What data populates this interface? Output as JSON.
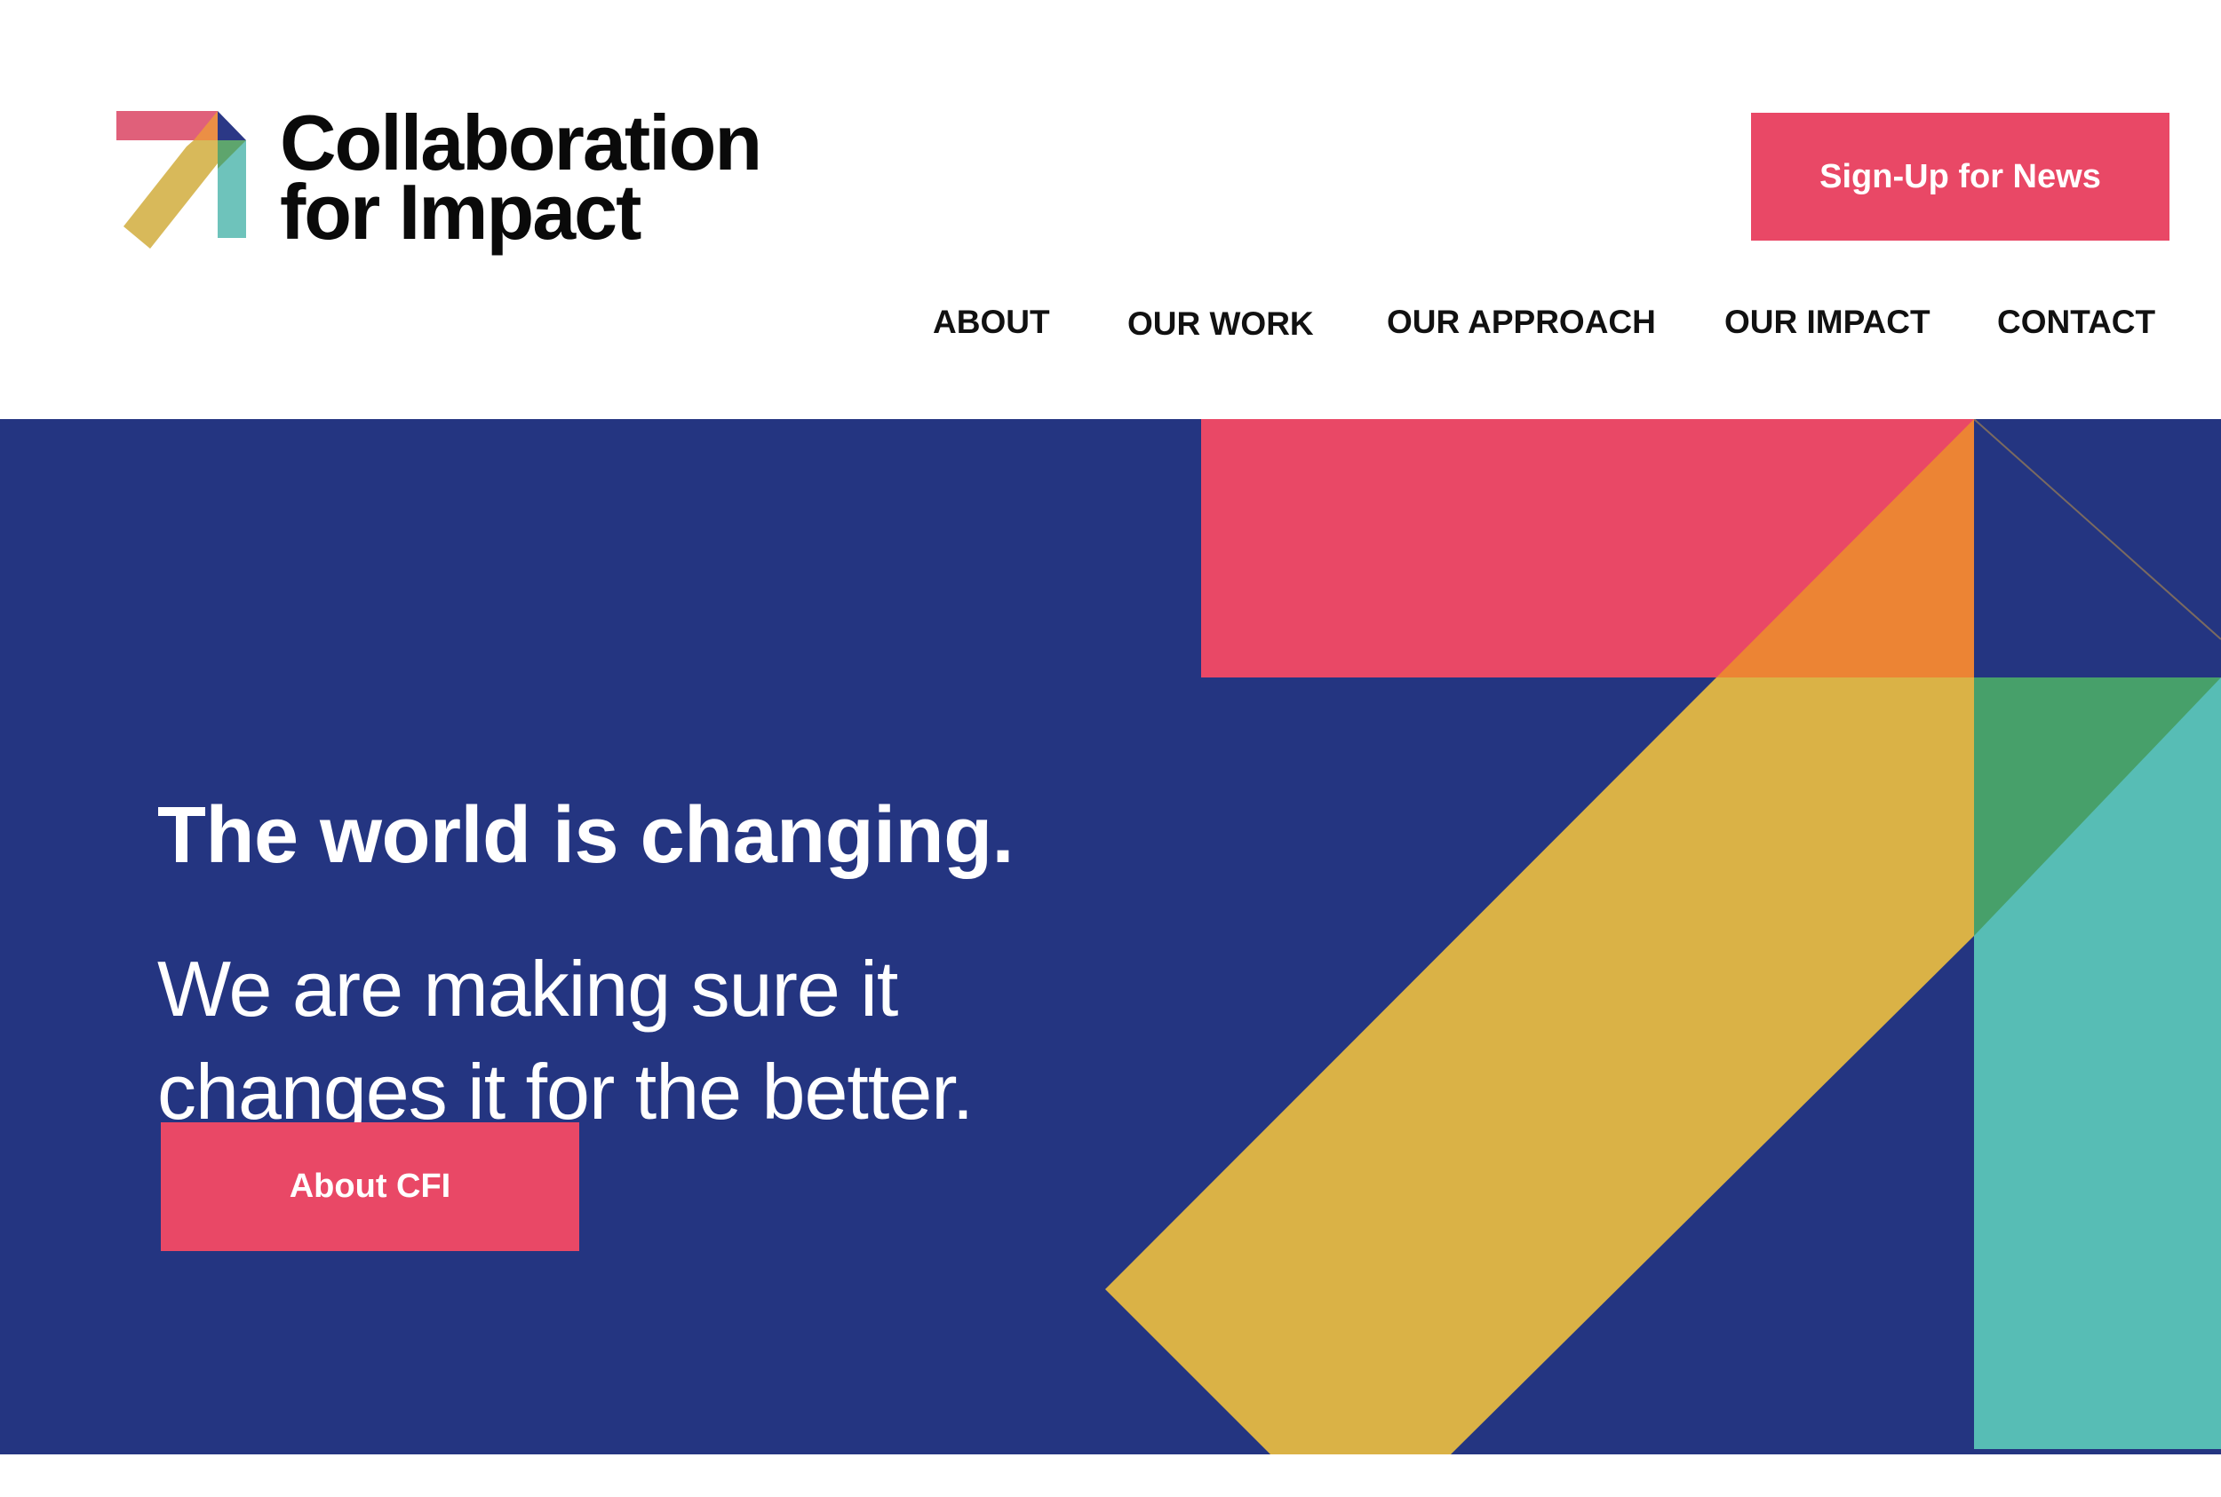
{
  "header": {
    "logo": {
      "line1": "Collaboration",
      "line2": "for Impact",
      "icon": "cfi-arrow-logo-icon"
    },
    "signup_label": "Sign-Up for News"
  },
  "nav": {
    "items": [
      {
        "label": "ABOUT"
      },
      {
        "label": "OUR WORK"
      },
      {
        "label": "OUR APPROACH"
      },
      {
        "label": "OUR IMPACT"
      },
      {
        "label": "CONTACT"
      }
    ]
  },
  "hero": {
    "headline": "The world is changing.",
    "subheadline_line1": "We are making sure it",
    "subheadline_line2": "changes it for the better.",
    "cta_label": "About CFI"
  },
  "colors": {
    "navy": "#243581",
    "pink": "#e94866",
    "yellow": "#dab246",
    "orange": "#ec8434",
    "teal": "#57bdb5",
    "green": "#47a06a",
    "text": "#0a0a0a",
    "white": "#ffffff"
  }
}
